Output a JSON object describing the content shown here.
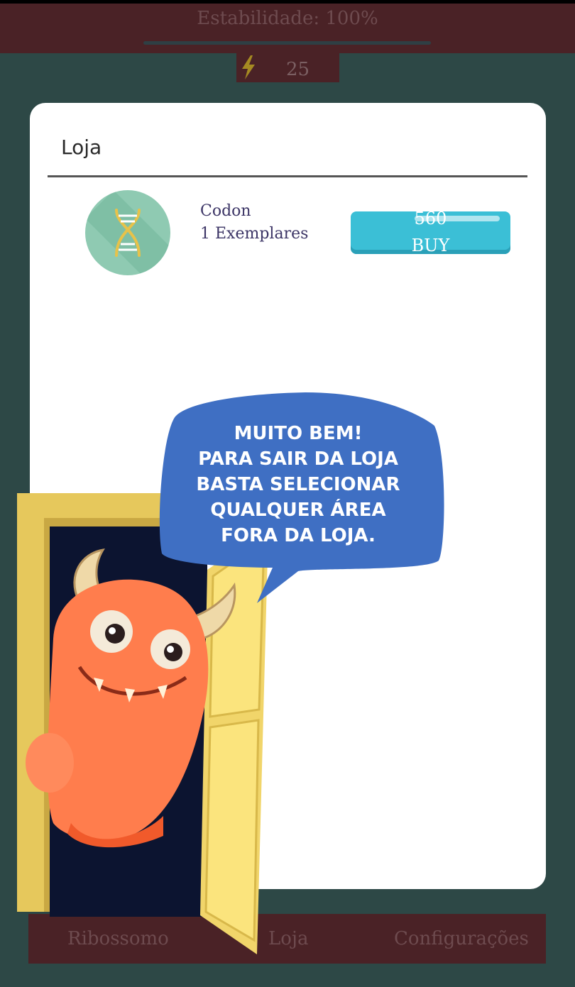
{
  "header": {
    "stability_label": "Estabilidade: 100%",
    "stability_value": 1.0,
    "energy_icon": "lightning-icon",
    "energy_value": "25"
  },
  "shop": {
    "title": "Loja",
    "item": {
      "icon": "dna-icon",
      "name": "Codon",
      "count_label": "1 Exemplares",
      "price": "560",
      "buy_label": "BUY"
    }
  },
  "tutorial": {
    "message": "MUITO BEM!\nPARA SAIR DA LOJA\nBASTA SELECIONAR\nQUALQUER ÁREA\nFORA DA LOJA."
  },
  "nav": {
    "items": [
      {
        "label": "Ribossomo"
      },
      {
        "label": "Loja"
      },
      {
        "label": "Configurações"
      }
    ]
  },
  "colors": {
    "background": "#2d4846",
    "bar": "#4a2226",
    "buy_button": "#3bbfd6",
    "speech_bubble": "#3f6fc3"
  }
}
